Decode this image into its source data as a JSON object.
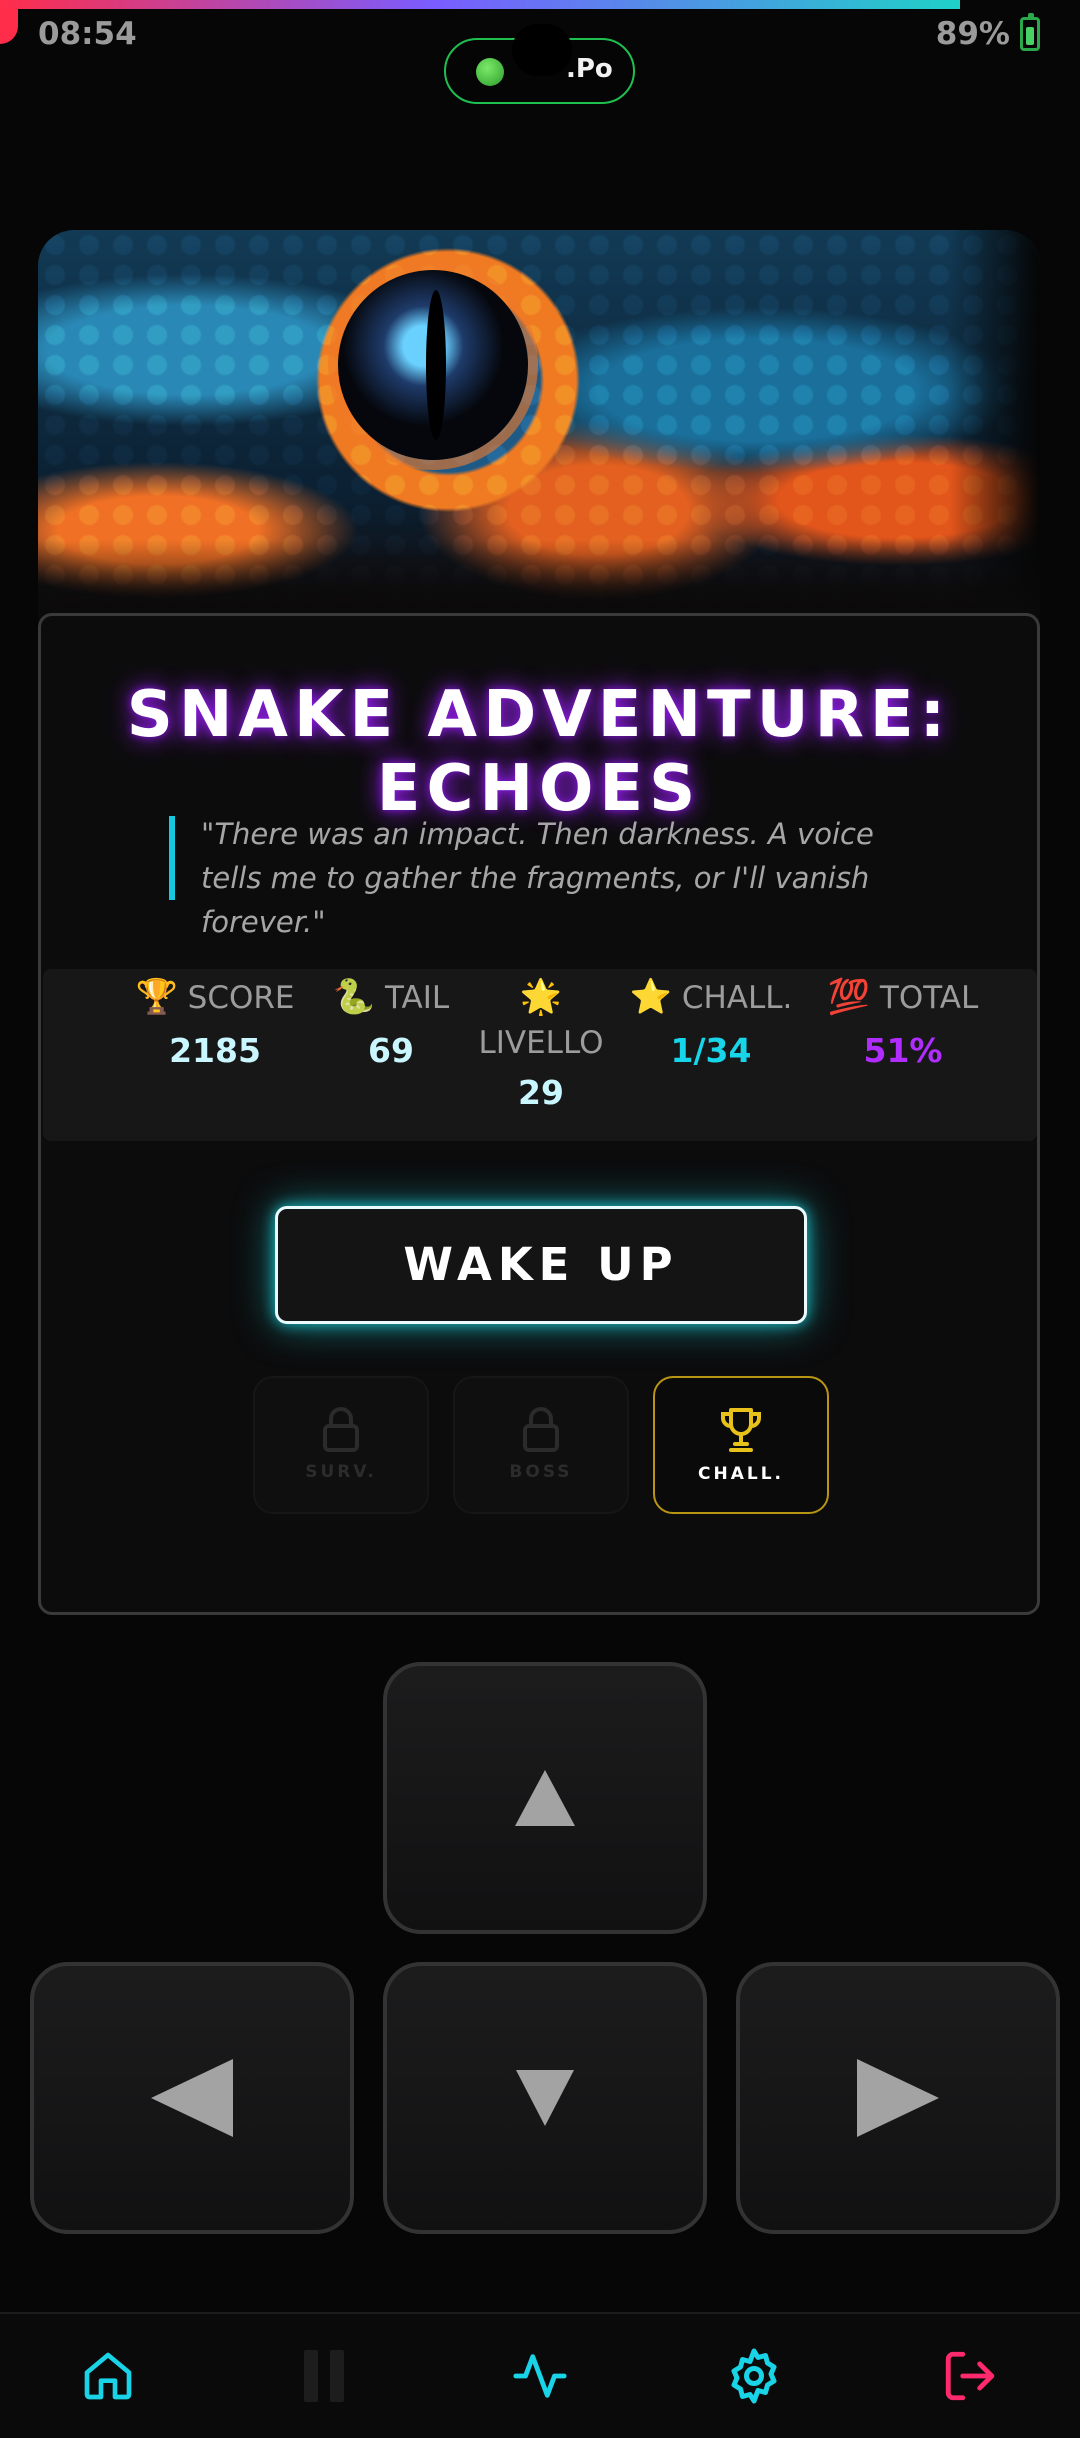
{
  "status_bar": {
    "time": "08:54",
    "battery": "89%"
  },
  "pill": {
    "label": ".Po"
  },
  "game": {
    "title": "SNAKE ADVENTURE: ECHOES",
    "quote": "\"There was an impact. Then darkness. A voice tells me to gather the fragments, or I'll vanish forever.\""
  },
  "stats": [
    {
      "emoji": "🏆",
      "label": "SCORE",
      "value": "2185",
      "color": "#c9f6ff"
    },
    {
      "emoji": "🐍",
      "label": "TAIL",
      "value": "69",
      "color": "#c9f6ff"
    },
    {
      "emoji": "🌟",
      "label": "LIVELLO",
      "value": "29",
      "color": "#c9f6ff"
    },
    {
      "emoji": "⭐",
      "label": "CHALL.",
      "value": "1/34",
      "color": "#18d6ea"
    },
    {
      "emoji": "💯",
      "label": "TOTAL",
      "value": "51%",
      "color": "#b12cff"
    }
  ],
  "wake_button": {
    "label": "WAKE UP"
  },
  "modes": [
    {
      "label": "SURV.",
      "icon": "lock-icon",
      "locked": true
    },
    {
      "label": "BOSS",
      "icon": "lock-icon",
      "locked": true
    },
    {
      "label": "CHALL.",
      "icon": "trophy-icon",
      "locked": false
    }
  ],
  "dpad": {
    "up": "up-arrow-icon",
    "left": "left-arrow-icon",
    "down": "down-arrow-icon",
    "right": "right-arrow-icon"
  },
  "bottom_nav": [
    {
      "icon": "home-icon",
      "color": "#19d3e6"
    },
    {
      "icon": "pause-icon",
      "color": "#1d1d1d"
    },
    {
      "icon": "activity-icon",
      "color": "#19d3e6"
    },
    {
      "icon": "gear-icon",
      "color": "#19d3e6"
    },
    {
      "icon": "logout-icon",
      "color": "#ff2a6d"
    }
  ],
  "colors": {
    "accent_cyan": "#19d3e6",
    "title_glow": "#a020ff",
    "gold": "#e8c21a",
    "logout": "#ff2a6d"
  }
}
